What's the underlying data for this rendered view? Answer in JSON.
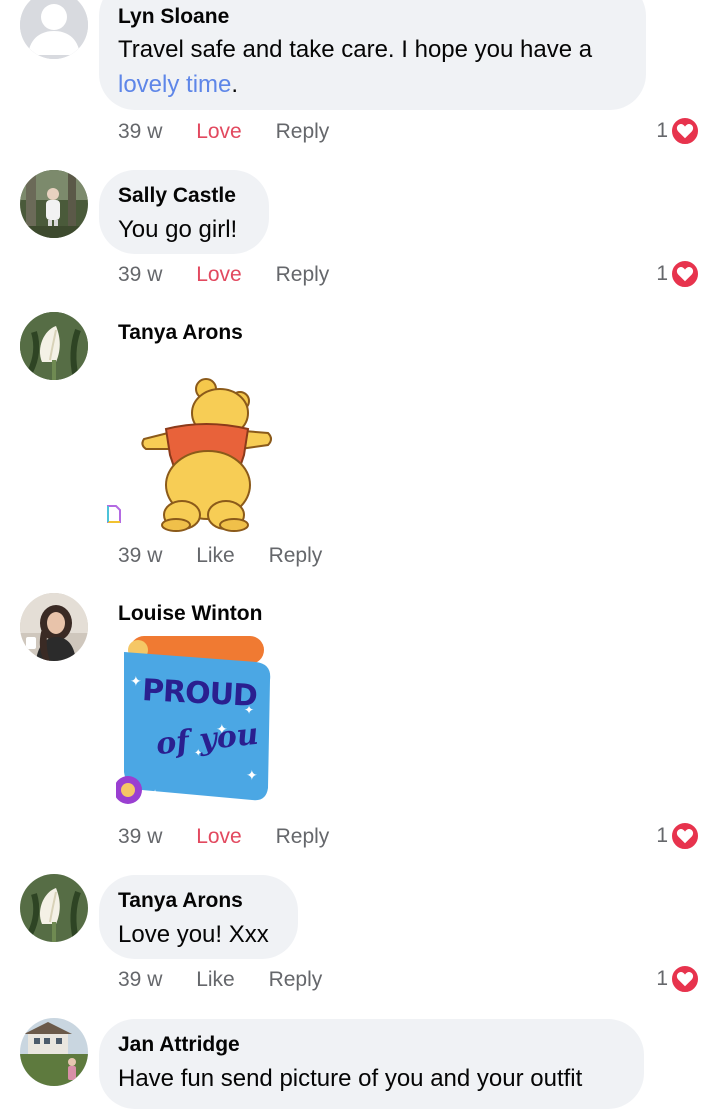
{
  "comments": [
    {
      "author": "Lyn Sloane",
      "text_prefix": "Travel safe and take care.  I hope you have a",
      "link_text": "lovely time",
      "text_suffix": ".",
      "time": "39 w",
      "action_primary": "Love",
      "action_reply": "Reply",
      "reaction_count": "1"
    },
    {
      "author": "Sally Castle",
      "text": "You go girl!",
      "time": "39 w",
      "action_primary": "Love",
      "action_reply": "Reply",
      "reaction_count": "1"
    },
    {
      "author": "Tanya Arons",
      "sticker": "winnie-the-pooh-dancing",
      "time": "39 w",
      "action_primary": "Like",
      "action_reply": "Reply"
    },
    {
      "author": "Louise Winton",
      "sticker": "proud-of-you-scroll",
      "sticker_text_top": "PROUD",
      "sticker_text_bottom": "of you",
      "time": "39 w",
      "action_primary": "Love",
      "action_reply": "Reply",
      "reaction_count": "1"
    },
    {
      "author": "Tanya Arons",
      "text": "Love you! Xxx",
      "time": "39 w",
      "action_primary": "Like",
      "action_reply": "Reply",
      "reaction_count": "1"
    },
    {
      "author": "Jan Attridge",
      "text": "Have fun send picture of you and your outfit"
    }
  ],
  "colors": {
    "bubble": "#f0f2f5",
    "love": "#e2495f",
    "link": "#5e86e8",
    "meta": "#65676b",
    "heart": "#e7334d"
  }
}
